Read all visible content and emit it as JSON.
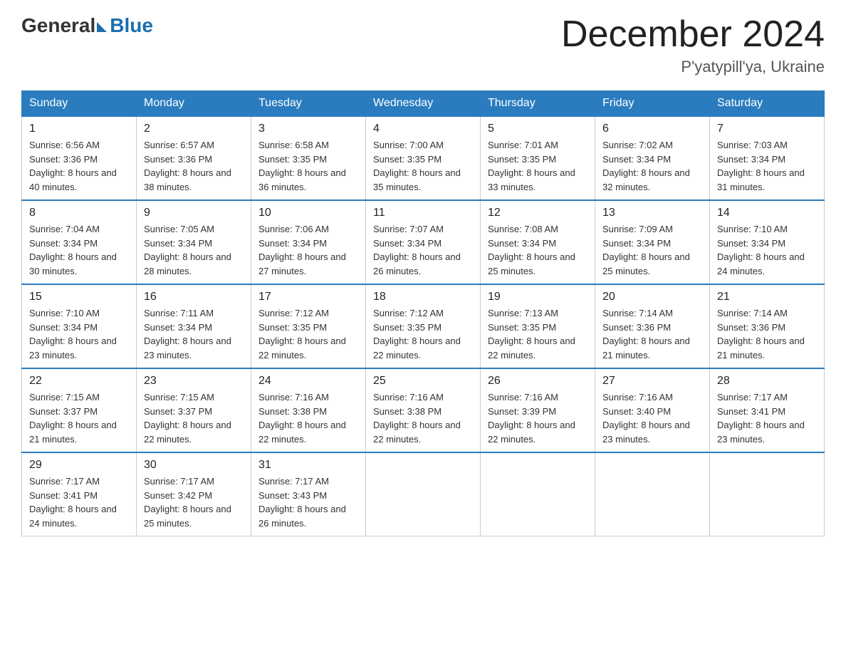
{
  "header": {
    "logo_general": "General",
    "logo_blue": "Blue",
    "title": "December 2024",
    "subtitle": "P'yatypill'ya, Ukraine"
  },
  "days_of_week": [
    "Sunday",
    "Monday",
    "Tuesday",
    "Wednesday",
    "Thursday",
    "Friday",
    "Saturday"
  ],
  "weeks": [
    [
      {
        "day": "1",
        "sunrise": "Sunrise: 6:56 AM",
        "sunset": "Sunset: 3:36 PM",
        "daylight": "Daylight: 8 hours and 40 minutes."
      },
      {
        "day": "2",
        "sunrise": "Sunrise: 6:57 AM",
        "sunset": "Sunset: 3:36 PM",
        "daylight": "Daylight: 8 hours and 38 minutes."
      },
      {
        "day": "3",
        "sunrise": "Sunrise: 6:58 AM",
        "sunset": "Sunset: 3:35 PM",
        "daylight": "Daylight: 8 hours and 36 minutes."
      },
      {
        "day": "4",
        "sunrise": "Sunrise: 7:00 AM",
        "sunset": "Sunset: 3:35 PM",
        "daylight": "Daylight: 8 hours and 35 minutes."
      },
      {
        "day": "5",
        "sunrise": "Sunrise: 7:01 AM",
        "sunset": "Sunset: 3:35 PM",
        "daylight": "Daylight: 8 hours and 33 minutes."
      },
      {
        "day": "6",
        "sunrise": "Sunrise: 7:02 AM",
        "sunset": "Sunset: 3:34 PM",
        "daylight": "Daylight: 8 hours and 32 minutes."
      },
      {
        "day": "7",
        "sunrise": "Sunrise: 7:03 AM",
        "sunset": "Sunset: 3:34 PM",
        "daylight": "Daylight: 8 hours and 31 minutes."
      }
    ],
    [
      {
        "day": "8",
        "sunrise": "Sunrise: 7:04 AM",
        "sunset": "Sunset: 3:34 PM",
        "daylight": "Daylight: 8 hours and 30 minutes."
      },
      {
        "day": "9",
        "sunrise": "Sunrise: 7:05 AM",
        "sunset": "Sunset: 3:34 PM",
        "daylight": "Daylight: 8 hours and 28 minutes."
      },
      {
        "day": "10",
        "sunrise": "Sunrise: 7:06 AM",
        "sunset": "Sunset: 3:34 PM",
        "daylight": "Daylight: 8 hours and 27 minutes."
      },
      {
        "day": "11",
        "sunrise": "Sunrise: 7:07 AM",
        "sunset": "Sunset: 3:34 PM",
        "daylight": "Daylight: 8 hours and 26 minutes."
      },
      {
        "day": "12",
        "sunrise": "Sunrise: 7:08 AM",
        "sunset": "Sunset: 3:34 PM",
        "daylight": "Daylight: 8 hours and 25 minutes."
      },
      {
        "day": "13",
        "sunrise": "Sunrise: 7:09 AM",
        "sunset": "Sunset: 3:34 PM",
        "daylight": "Daylight: 8 hours and 25 minutes."
      },
      {
        "day": "14",
        "sunrise": "Sunrise: 7:10 AM",
        "sunset": "Sunset: 3:34 PM",
        "daylight": "Daylight: 8 hours and 24 minutes."
      }
    ],
    [
      {
        "day": "15",
        "sunrise": "Sunrise: 7:10 AM",
        "sunset": "Sunset: 3:34 PM",
        "daylight": "Daylight: 8 hours and 23 minutes."
      },
      {
        "day": "16",
        "sunrise": "Sunrise: 7:11 AM",
        "sunset": "Sunset: 3:34 PM",
        "daylight": "Daylight: 8 hours and 23 minutes."
      },
      {
        "day": "17",
        "sunrise": "Sunrise: 7:12 AM",
        "sunset": "Sunset: 3:35 PM",
        "daylight": "Daylight: 8 hours and 22 minutes."
      },
      {
        "day": "18",
        "sunrise": "Sunrise: 7:12 AM",
        "sunset": "Sunset: 3:35 PM",
        "daylight": "Daylight: 8 hours and 22 minutes."
      },
      {
        "day": "19",
        "sunrise": "Sunrise: 7:13 AM",
        "sunset": "Sunset: 3:35 PM",
        "daylight": "Daylight: 8 hours and 22 minutes."
      },
      {
        "day": "20",
        "sunrise": "Sunrise: 7:14 AM",
        "sunset": "Sunset: 3:36 PM",
        "daylight": "Daylight: 8 hours and 21 minutes."
      },
      {
        "day": "21",
        "sunrise": "Sunrise: 7:14 AM",
        "sunset": "Sunset: 3:36 PM",
        "daylight": "Daylight: 8 hours and 21 minutes."
      }
    ],
    [
      {
        "day": "22",
        "sunrise": "Sunrise: 7:15 AM",
        "sunset": "Sunset: 3:37 PM",
        "daylight": "Daylight: 8 hours and 21 minutes."
      },
      {
        "day": "23",
        "sunrise": "Sunrise: 7:15 AM",
        "sunset": "Sunset: 3:37 PM",
        "daylight": "Daylight: 8 hours and 22 minutes."
      },
      {
        "day": "24",
        "sunrise": "Sunrise: 7:16 AM",
        "sunset": "Sunset: 3:38 PM",
        "daylight": "Daylight: 8 hours and 22 minutes."
      },
      {
        "day": "25",
        "sunrise": "Sunrise: 7:16 AM",
        "sunset": "Sunset: 3:38 PM",
        "daylight": "Daylight: 8 hours and 22 minutes."
      },
      {
        "day": "26",
        "sunrise": "Sunrise: 7:16 AM",
        "sunset": "Sunset: 3:39 PM",
        "daylight": "Daylight: 8 hours and 22 minutes."
      },
      {
        "day": "27",
        "sunrise": "Sunrise: 7:16 AM",
        "sunset": "Sunset: 3:40 PM",
        "daylight": "Daylight: 8 hours and 23 minutes."
      },
      {
        "day": "28",
        "sunrise": "Sunrise: 7:17 AM",
        "sunset": "Sunset: 3:41 PM",
        "daylight": "Daylight: 8 hours and 23 minutes."
      }
    ],
    [
      {
        "day": "29",
        "sunrise": "Sunrise: 7:17 AM",
        "sunset": "Sunset: 3:41 PM",
        "daylight": "Daylight: 8 hours and 24 minutes."
      },
      {
        "day": "30",
        "sunrise": "Sunrise: 7:17 AM",
        "sunset": "Sunset: 3:42 PM",
        "daylight": "Daylight: 8 hours and 25 minutes."
      },
      {
        "day": "31",
        "sunrise": "Sunrise: 7:17 AM",
        "sunset": "Sunset: 3:43 PM",
        "daylight": "Daylight: 8 hours and 26 minutes."
      },
      null,
      null,
      null,
      null
    ]
  ]
}
